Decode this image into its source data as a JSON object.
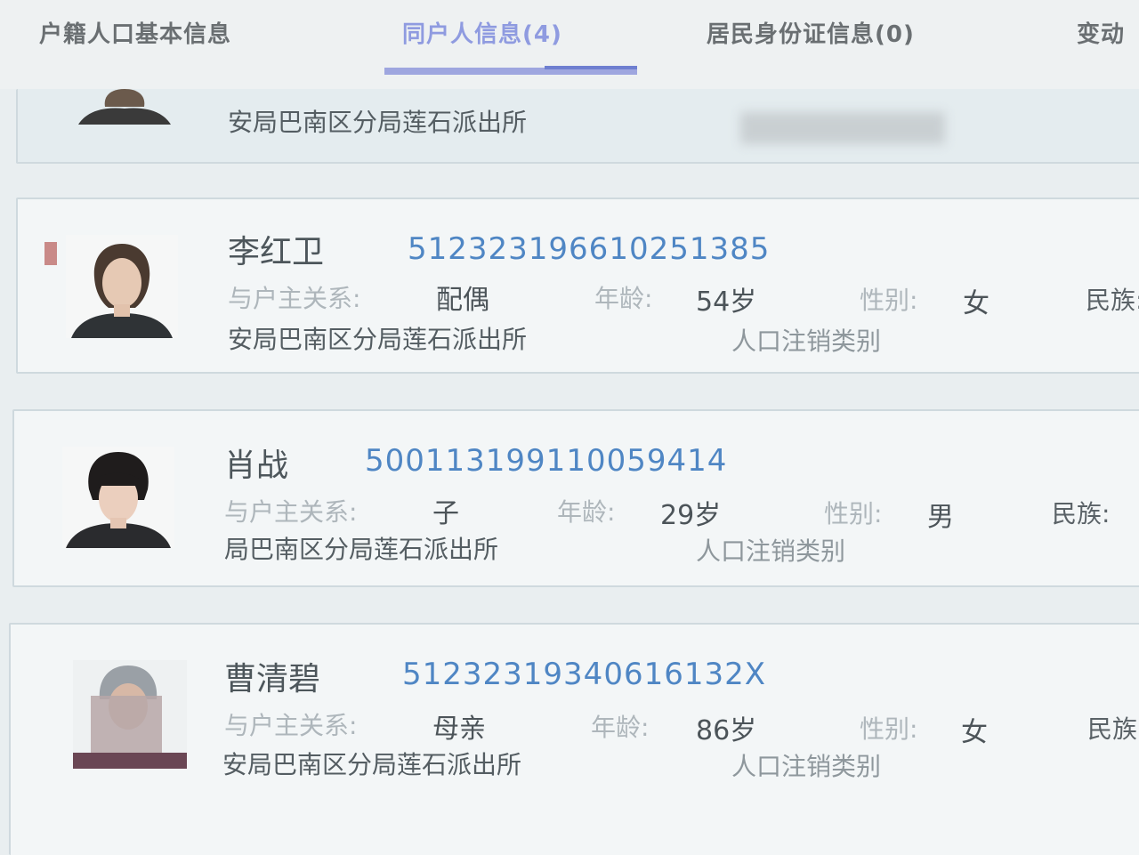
{
  "tabs": [
    {
      "label": "户籍人口基本信息"
    },
    {
      "label": "同户人信息(4)"
    },
    {
      "label": "居民身份证信息(0)"
    },
    {
      "label": "变动"
    }
  ],
  "partial_card": {
    "office": "安局巴南区分局莲石派出所"
  },
  "labels": {
    "relation": "与户主关系:",
    "age": "年龄:",
    "gender": "性别:",
    "ethnicity": "民族:",
    "cancel_type": "人口注销类别"
  },
  "persons": [
    {
      "name": "李红卫",
      "id": "512323196610251385",
      "relation": "配偶",
      "age": "54岁",
      "gender": "女",
      "office": "安局巴南区分局莲石派出所"
    },
    {
      "name": "肖战",
      "id": "500113199110059414",
      "relation": "子",
      "age": "29岁",
      "gender": "男",
      "office": "局巴南区分局莲石派出所"
    },
    {
      "name": "曹清碧",
      "id": "51232319340616132X",
      "relation": "母亲",
      "age": "86岁",
      "gender": "女",
      "office": "安局巴南区分局莲石派出所"
    }
  ]
}
